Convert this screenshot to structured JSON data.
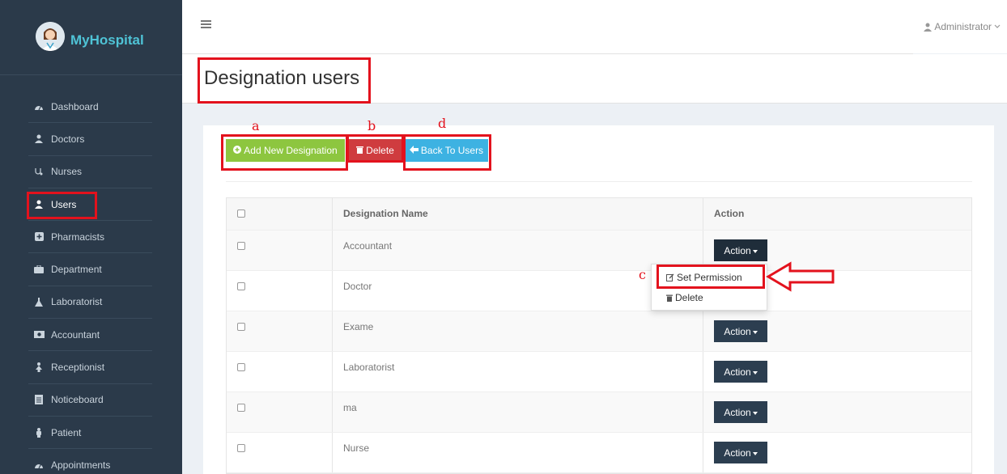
{
  "app": {
    "name": "MyHospital"
  },
  "sidebar": {
    "items": [
      {
        "label": "Dashboard",
        "icon": "dashboard-icon"
      },
      {
        "label": "Doctors",
        "icon": "user-md-icon"
      },
      {
        "label": "Nurses",
        "icon": "stethoscope-icon"
      },
      {
        "label": "Users",
        "icon": "user-icon"
      },
      {
        "label": "Pharmacists",
        "icon": "plus-square-icon"
      },
      {
        "label": "Department",
        "icon": "briefcase-icon"
      },
      {
        "label": "Laboratorist",
        "icon": "flask-icon"
      },
      {
        "label": "Accountant",
        "icon": "money-icon"
      },
      {
        "label": "Receptionist",
        "icon": "female-icon"
      },
      {
        "label": "Noticeboard",
        "icon": "file-text-icon"
      },
      {
        "label": "Patient",
        "icon": "male-icon"
      },
      {
        "label": "Appointments",
        "icon": "dashboard-icon"
      }
    ],
    "active": "Users"
  },
  "header": {
    "user": "Administrator"
  },
  "page": {
    "title": "Designation users"
  },
  "toolbar": {
    "add_label": "Add New Designation",
    "delete_label": "Delete",
    "back_label": "Back To Users"
  },
  "annotations": {
    "a": "a",
    "b": "b",
    "c": "c",
    "d": "d"
  },
  "table": {
    "headers": [
      "Designation Name",
      "Action"
    ],
    "action_label": "Action",
    "rows": [
      "Accountant",
      "Doctor",
      "Exame",
      "Laboratorist",
      "ma",
      "Nurse"
    ]
  },
  "dropdown": {
    "set_permission": "Set Permission",
    "delete": "Delete"
  },
  "colors": {
    "sidebar": "#2b3a4a",
    "add": "#8dc63f",
    "delete": "#cf3c3f",
    "back": "#3db2e2",
    "action": "#2c3e50",
    "highlight": "#e3121d"
  }
}
